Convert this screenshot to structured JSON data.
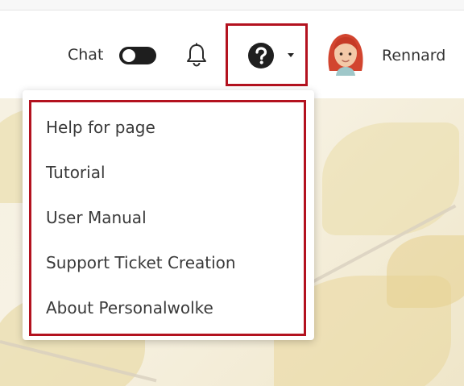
{
  "header": {
    "chat_label": "Chat",
    "chat_toggle_state": "off",
    "notifications_icon": "bell-icon",
    "help_icon": "question-circle-icon",
    "user": {
      "name": "Rennard",
      "avatar_icon": "avatar-red-hair-icon"
    }
  },
  "help_menu": {
    "items": [
      {
        "label": "Help for page"
      },
      {
        "label": "Tutorial"
      },
      {
        "label": "User Manual"
      },
      {
        "label": "Support Ticket Creation"
      },
      {
        "label": "About Personalwolke"
      }
    ]
  },
  "colors": {
    "highlight": "#b3121f",
    "toggle": "#1e1e1e",
    "text": "#3a3a3a"
  }
}
